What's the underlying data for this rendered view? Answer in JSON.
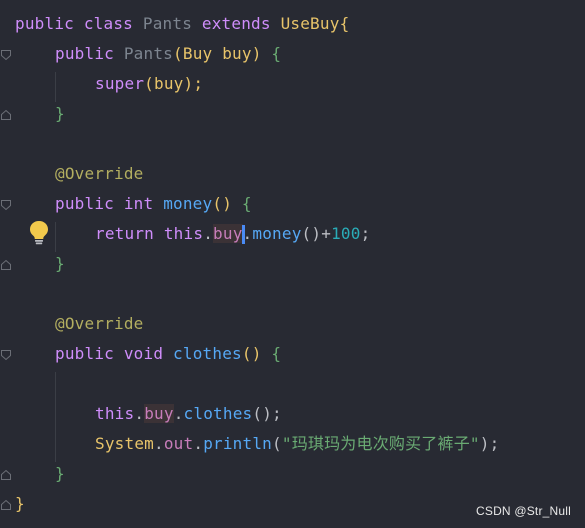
{
  "code": {
    "line1": {
      "kw1": "public",
      "kw2": "class",
      "class_name": "Pants",
      "kw3": "extends",
      "super_name": "UseBuy",
      "brace": "{"
    },
    "line2": {
      "kw1": "public",
      "ctor": "Pants",
      "lparen": "(",
      "param_type": "Buy",
      "param_name": "buy",
      "rparen": ")",
      "brace": "{"
    },
    "line3": {
      "kw": "super",
      "lparen": "(",
      "arg": "buy",
      "rparen": ");"
    },
    "line4": {
      "brace": "}"
    },
    "line6": {
      "ann": "@Override"
    },
    "line7": {
      "kw1": "public",
      "kw2": "int",
      "fn": "money",
      "parens": "()",
      "brace": "{"
    },
    "line8": {
      "kw": "return",
      "this": "this",
      "dot1": ".",
      "field": "buy",
      "dot2": ".",
      "fn": "money",
      "parens": "()",
      "op": "+",
      "num": "100",
      "semi": ";"
    },
    "line9": {
      "brace": "}"
    },
    "line11": {
      "ann": "@Override"
    },
    "line12": {
      "kw1": "public",
      "kw2": "void",
      "fn": "clothes",
      "parens": "()",
      "brace": "{"
    },
    "line14": {
      "this": "this",
      "dot1": ".",
      "field": "buy",
      "dot2": ".",
      "fn": "clothes",
      "parens": "();"
    },
    "line15": {
      "cls": "System",
      "dot1": ".",
      "field": "out",
      "dot2": ".",
      "fn": "println",
      "lparen": "(",
      "str": "\"玛琪玛为电次购买了裤子\"",
      "rparen": ");"
    },
    "line16": {
      "brace": "}"
    },
    "line17": {
      "brace": "}"
    }
  },
  "watermark": "CSDN @Str_Null",
  "icons": {
    "bulb": "lightbulb-icon",
    "fold": "fold-icon"
  },
  "colors": {
    "background": "#282a33",
    "keyword": "#cf8dfb",
    "function": "#56a8f5",
    "number": "#2aacb8",
    "string": "#6aab73",
    "annotation": "#b3ae60",
    "field": "#c77dbb",
    "caret": "#4a8bf5",
    "bulb": "#f2c94c"
  }
}
